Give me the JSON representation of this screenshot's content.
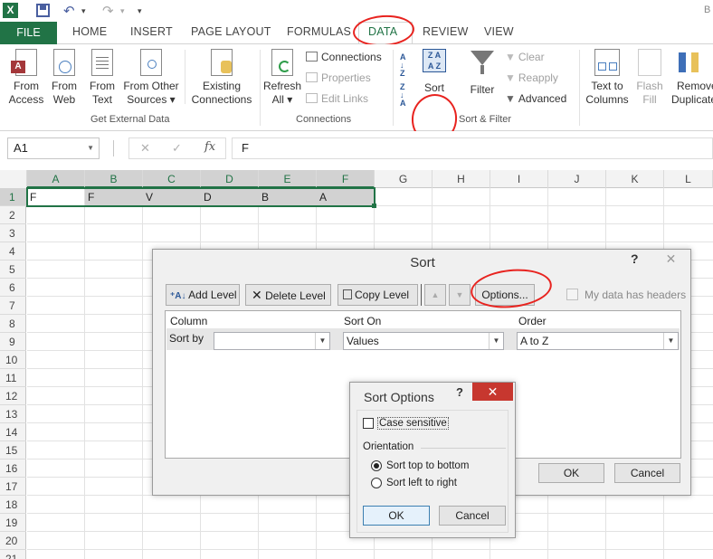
{
  "qat": {
    "undo": "↶",
    "redo": "↷",
    "more": "▾",
    "cut": "B"
  },
  "tabs": [
    "FILE",
    "HOME",
    "INSERT",
    "PAGE LAYOUT",
    "FORMULAS",
    "DATA",
    "REVIEW",
    "VIEW"
  ],
  "ribbon": {
    "get_external": {
      "from_access": [
        "From",
        "Access"
      ],
      "from_web": [
        "From",
        "Web"
      ],
      "from_text": [
        "From",
        "Text"
      ],
      "from_other": [
        "From Other",
        "Sources ▾"
      ],
      "existing": [
        "Existing",
        "Connections"
      ],
      "group": "Get External Data"
    },
    "connections": {
      "refresh": [
        "Refresh",
        "All ▾"
      ],
      "connections": "Connections",
      "properties": "Properties",
      "edit_links": "Edit Links",
      "group": "Connections"
    },
    "sort_filter": {
      "sort": "Sort",
      "filter": "Filter",
      "clear": "Clear",
      "reapply": "Reapply",
      "advanced": "Advanced",
      "group": "Sort & Filter"
    },
    "tools": {
      "text_to_columns": [
        "Text to",
        "Columns"
      ],
      "flash_fill": [
        "Flash",
        "Fill"
      ],
      "remove_dup": [
        "Remove",
        "Duplicate"
      ]
    }
  },
  "formula_bar": {
    "name_box": "A1",
    "fx": "fx",
    "value": "F",
    "cancel": "✕",
    "enter": "✓"
  },
  "columns": [
    "A",
    "B",
    "C",
    "D",
    "E",
    "F",
    "G",
    "H",
    "I",
    "J",
    "K",
    "L"
  ],
  "rows": [
    "1",
    "2",
    "3",
    "4",
    "5",
    "6",
    "7",
    "8",
    "9",
    "10",
    "11",
    "12",
    "13",
    "14",
    "15",
    "16",
    "17",
    "18",
    "19",
    "20",
    "21"
  ],
  "row1_cells": [
    "F",
    "F",
    "V",
    "D",
    "B",
    "A"
  ],
  "sort_dialog": {
    "title": "Sort",
    "help": "?",
    "close": "✕",
    "add_level": "Add Level",
    "delete_level": "Delete Level",
    "copy_level": "Copy Level",
    "options": "Options...",
    "headers_label": "My data has headers",
    "col_column": "Column",
    "col_sort_on": "Sort On",
    "col_order": "Order",
    "sort_by": "Sort by",
    "sort_on_value": "Values",
    "order_value": "A to Z",
    "ok": "OK",
    "cancel": "Cancel"
  },
  "sort_options": {
    "title": "Sort Options",
    "help": "?",
    "close": "✕",
    "case_sensitive": "Case sensitive",
    "orientation": "Orientation",
    "top_to_bottom": "Sort top to bottom",
    "left_to_right": "Sort left to right",
    "ok": "OK",
    "cancel": "Cancel"
  },
  "colors": {
    "excel_green": "#217346",
    "accent_red": "#c7372f",
    "annotation_red": "#e8231f"
  }
}
